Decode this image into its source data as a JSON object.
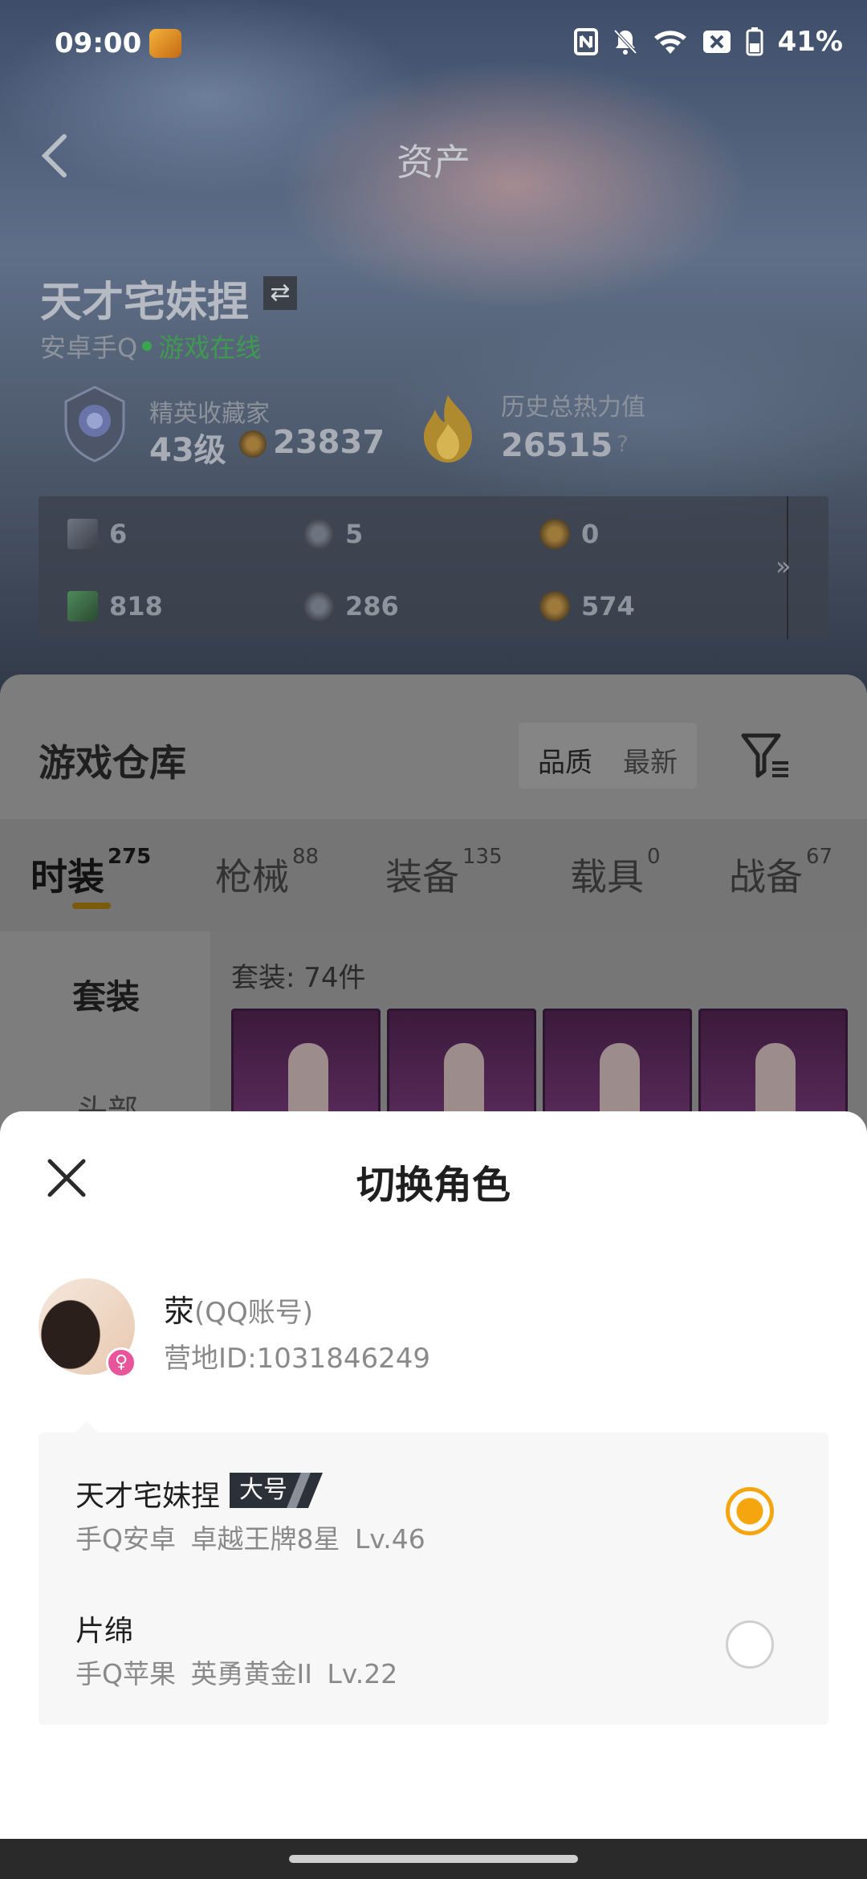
{
  "status_bar": {
    "time": "09:00",
    "battery": "41%",
    "icons": [
      "nfc-icon",
      "mute-icon",
      "wifi-icon",
      "sim-icon",
      "battery-icon"
    ]
  },
  "header": {
    "title": "资产"
  },
  "profile": {
    "name": "天才宅妹捏",
    "platform": "安卓手Q",
    "status": "游戏在线",
    "rank_title": "精英收藏家",
    "rank_level": "43级",
    "coins": "23837",
    "heat_title": "历史总热力值",
    "heat_value": "26515",
    "heat_help": "?"
  },
  "stats": {
    "row1": [
      "6",
      "5",
      "0"
    ],
    "row2": [
      "818",
      "286",
      "574"
    ],
    "more": "»"
  },
  "warehouse": {
    "title": "游戏仓库",
    "sort_quality": "品质",
    "sort_newest": "最新",
    "tabs": [
      {
        "label": "时装",
        "count": "275"
      },
      {
        "label": "枪械",
        "count": "88"
      },
      {
        "label": "装备",
        "count": "135"
      },
      {
        "label": "载具",
        "count": "0"
      },
      {
        "label": "战备",
        "count": "67"
      }
    ],
    "side_active": "套装",
    "side_item": "头部",
    "set_count": "套装: 74件"
  },
  "sheet": {
    "title": "切换角色",
    "account_name": "荥",
    "account_type": "(QQ账号)",
    "account_id": "营地ID:1031846249",
    "gender_symbol": "♀",
    "roles": [
      {
        "name": "天才宅妹捏",
        "tag": "大号",
        "detail": "手Q安卓  卓越王牌8星  Lv.46",
        "selected": true
      },
      {
        "name": "片绵",
        "tag": "",
        "detail": "手Q苹果  英勇黄金II  Lv.22",
        "selected": false
      }
    ],
    "colors": {
      "accent": "#f5a60e",
      "tag_bg": "#2c3038"
    }
  }
}
